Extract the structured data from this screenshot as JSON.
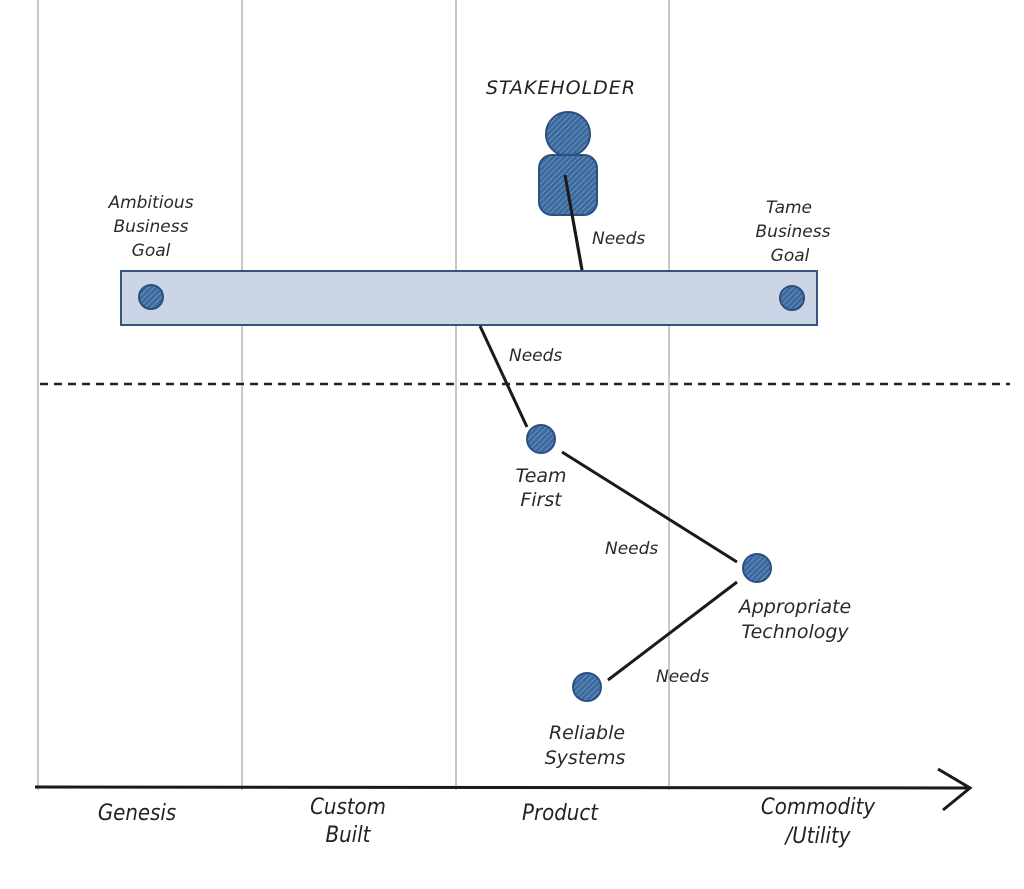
{
  "diagram": {
    "type": "wardley-map",
    "stakeholder": {
      "label": "STAKEHOLDER",
      "icon": "person-icon"
    },
    "goal_bar": {
      "left_label": [
        "Ambitious",
        "Business",
        "Goal"
      ],
      "right_label": [
        "Tame",
        "Business",
        "Goal"
      ]
    },
    "nodes": [
      {
        "id": "team-first",
        "label": [
          "Team",
          "First"
        ]
      },
      {
        "id": "appropriate-technology",
        "label": [
          "Appropriate",
          "Technology"
        ]
      },
      {
        "id": "reliable-systems",
        "label": [
          "Reliable",
          "Systems"
        ]
      }
    ],
    "edge_labels": [
      "Needs",
      "Needs",
      "Needs",
      "Needs"
    ],
    "axis": {
      "stages": [
        {
          "line1": "Genesis",
          "line2": ""
        },
        {
          "line1": "Custom",
          "line2": "Built"
        },
        {
          "line1": "Product",
          "line2": ""
        },
        {
          "line1": "Commodity",
          "line2": "/Utility"
        }
      ]
    },
    "colors": {
      "node": "#3d6a9e",
      "node_stroke": "#2b5080",
      "bar_fill": "#ccd5e6",
      "bar_stroke": "#34557f",
      "grid": "#c8c8c8",
      "line": "#1a1a1a"
    }
  }
}
